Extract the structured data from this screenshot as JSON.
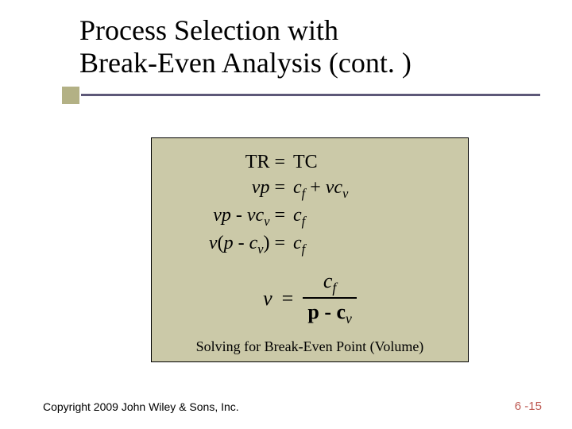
{
  "title_line1": "Process Selection with",
  "title_line2": "Break-Even Analysis (cont. )",
  "equations": {
    "row1": {
      "left": "TR",
      "right": "TC"
    },
    "row2": {
      "left_var": "vp",
      "right": "c_f + vc_v"
    },
    "row3": {
      "left": "vp - vc_v",
      "right": "c_f"
    },
    "row4": {
      "left": "v(p - c_v)",
      "right": "c_f"
    },
    "final": {
      "lhs": "v",
      "eq": "=",
      "num": "c_f",
      "den": "p - c_v"
    }
  },
  "caption": "Solving for Break-Even Point (Volume)",
  "footer_left": "Copyright 2009 John Wiley & Sons, Inc.",
  "footer_right": "6 -15",
  "colors": {
    "box_bg": "#cbc9a8",
    "rule": "#5d5878",
    "accent": "#b3b185",
    "page_num": "#be5a53"
  }
}
